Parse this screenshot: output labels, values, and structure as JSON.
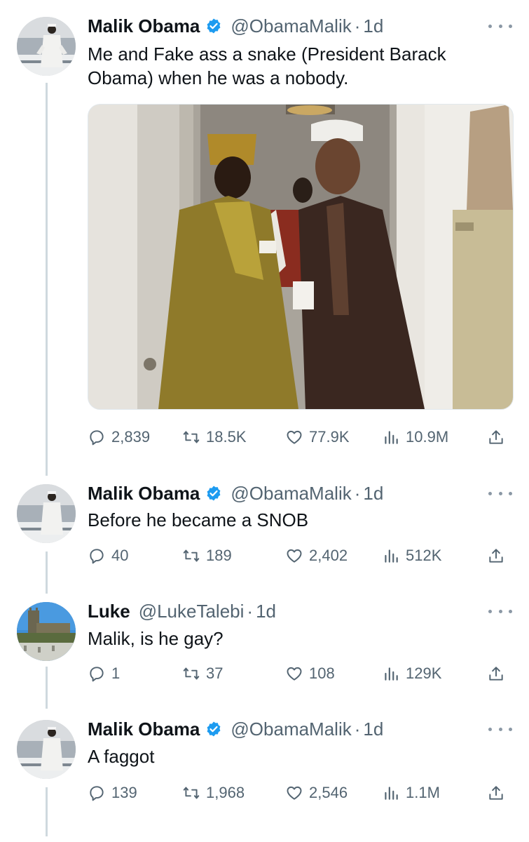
{
  "tweets": [
    {
      "name": "Malik Obama",
      "handle": "@ObamaMalik",
      "time": "1d",
      "text_lines": [
        "Me and Fake ass a snake (President Barack",
        "Obama) when he was a nobody."
      ],
      "verified": true,
      "has_media": true,
      "stats": {
        "replies": "2,839",
        "retweets": "18.5K",
        "likes": "77.9K",
        "views": "10.9M"
      }
    },
    {
      "name": "Malik Obama",
      "handle": "@ObamaMalik",
      "time": "1d",
      "text_lines": [
        "Before he became a SNOB"
      ],
      "verified": true,
      "stats": {
        "replies": "40",
        "retweets": "189",
        "likes": "2,402",
        "views": "512K"
      }
    },
    {
      "name": "Luke",
      "handle": "@LukeTalebi",
      "time": "1d",
      "text_lines": [
        "Malik, is he gay?"
      ],
      "verified": false,
      "stats": {
        "replies": "1",
        "retweets": "37",
        "likes": "108",
        "views": "129K"
      }
    },
    {
      "name": "Malik Obama",
      "handle": "@ObamaMalik",
      "time": "1d",
      "text_lines": [
        "A faggot"
      ],
      "verified": true,
      "stats": {
        "replies": "139",
        "retweets": "1,968",
        "likes": "2,546",
        "views": "1.1M"
      }
    }
  ],
  "separator": "·",
  "colors": {
    "verified": "#1d9bf0",
    "muted": "#536471",
    "thread_line": "#cfd9de"
  },
  "icons": [
    "reply-icon",
    "retweet-icon",
    "like-icon",
    "views-icon",
    "share-icon",
    "more-icon",
    "verified-badge-icon"
  ]
}
